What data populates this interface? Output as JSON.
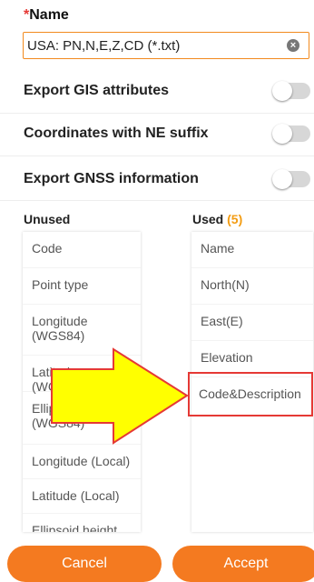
{
  "form": {
    "name_required_mark": "*",
    "name_label": "Name",
    "name_value": "USA: PN,N,E,Z,CD (*.txt)"
  },
  "toggles": [
    {
      "label": "Export GIS attributes",
      "on": false
    },
    {
      "label": "Coordinates with NE suffix",
      "on": false
    },
    {
      "label": "Export GNSS information",
      "on": false
    }
  ],
  "unused": {
    "header": "Unused",
    "items": [
      "Code",
      "Point type",
      "Longitude (WGS84)",
      "Latitude (WGS84)",
      "Ellipsoid height (WGS84)",
      "Longitude (Local)",
      "Latitude (Local)",
      "Ellipsoid height"
    ]
  },
  "used": {
    "header": "Used",
    "count": "(5)",
    "items": [
      "Name",
      "North(N)",
      "East(E)",
      "Elevation",
      "Code&Description"
    ]
  },
  "buttons": {
    "cancel": "Cancel",
    "accept": "Accept"
  },
  "colors": {
    "accent": "#f47a20",
    "required": "#e53935",
    "count": "#f39c12",
    "arrow_fill": "#ffff00",
    "highlight": "#e53935"
  },
  "annotations": {
    "arrow": "yellow-arrow-icon"
  }
}
